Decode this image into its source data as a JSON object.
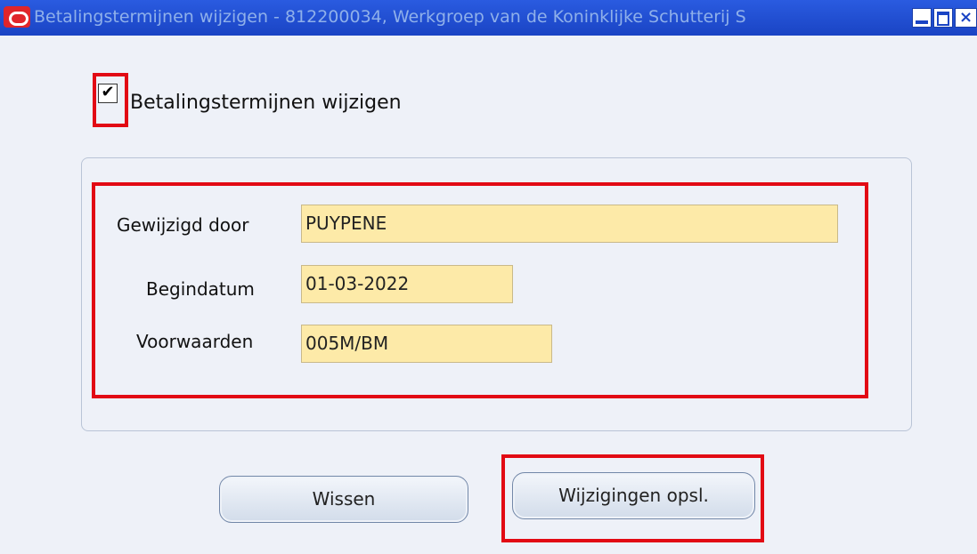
{
  "window": {
    "title": "Betalingstermijnen wijzigen - 812200034, Werkgroep van de Koninklijke Schutterij S"
  },
  "checkbox": {
    "label": "Betalingstermijnen wijzigen",
    "checked": true,
    "mark": "✔"
  },
  "fields": [
    {
      "label": "Gewijzigd door",
      "value": "PUYPENE"
    },
    {
      "label": "Begindatum",
      "value": "01-03-2022"
    },
    {
      "label": "Voorwaarden",
      "value": "005M/BM"
    }
  ],
  "buttons": {
    "clear": "Wissen",
    "save": "Wijzigingen opsl."
  },
  "icons": [
    "oracle-logo-icon",
    "minimize-icon",
    "maximize-icon",
    "close-icon",
    "checkmark-icon"
  ],
  "colors": {
    "highlight": "#e20a14",
    "field_bg": "#fdeaa8",
    "titlebar": "#1a44c4"
  }
}
